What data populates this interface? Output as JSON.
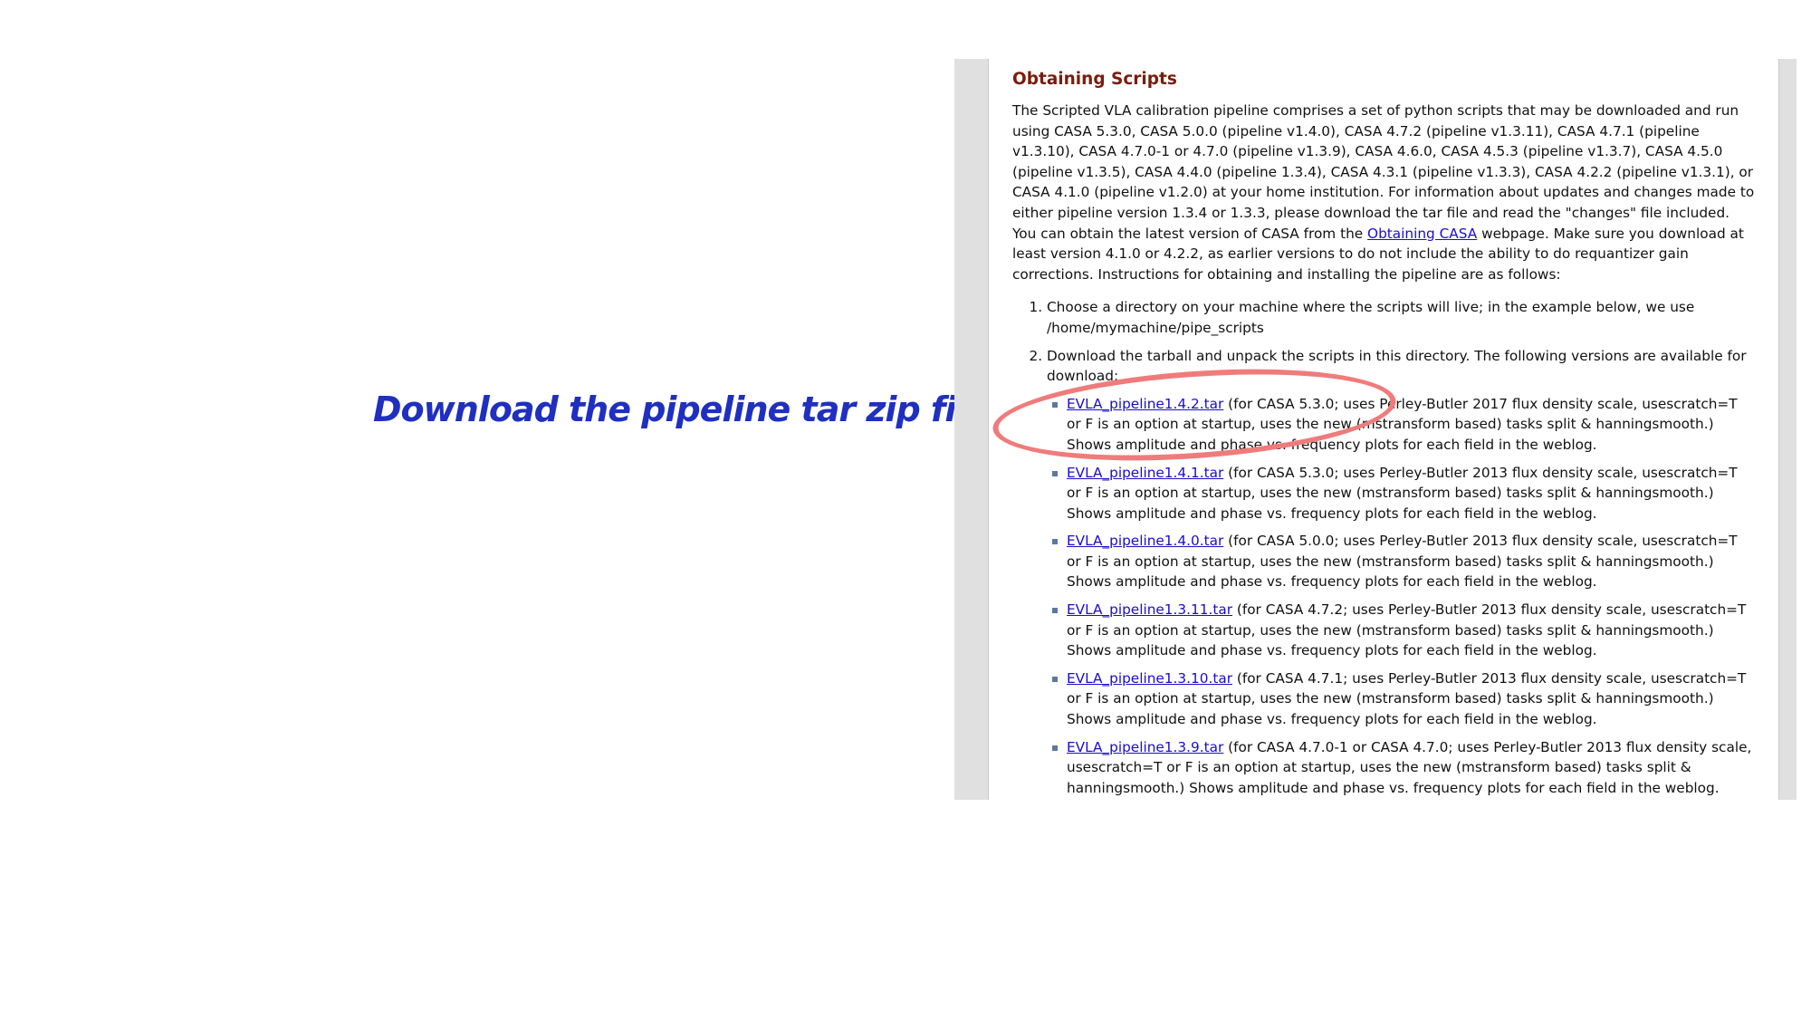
{
  "caption": "Download the pipeline tar zip file.",
  "page": {
    "heading": "Obtaining Scripts",
    "intro": {
      "part1": "The Scripted VLA calibration pipeline comprises a set of python scripts that may be downloaded and run using CASA 5.3.0, CASA 5.0.0 (pipeline v1.4.0),  CASA 4.7.2 (pipeline v1.3.11), CASA 4.7.1 (pipeline v1.3.10), CASA 4.7.0-1 or 4.7.0 (pipeline v1.3.9), CASA 4.6.0, CASA 4.5.3 (pipeline v1.3.7), CASA 4.5.0 (pipeline v1.3.5), CASA 4.4.0 (pipeline 1.3.4), CASA 4.3.1 (pipeline v1.3.3), CASA 4.2.2 (pipeline v1.3.1), or CASA 4.1.0 (pipeline v1.2.0) at your home institution. For information about updates and changes made to either pipeline version 1.3.4 or 1.3.3, please download the tar file and read the \"changes\" file included. You can obtain the latest version of CASA from the ",
      "link": "Obtaining CASA",
      "part2": " webpage.  Make sure you download at least version 4.1.0 or 4.2.2, as earlier versions to do not include the ability to do requantizer gain corrections.  Instructions for obtaining and installing the pipeline are as follows:"
    },
    "steps": [
      "Choose a directory on your machine where the scripts will live; in the example below, we use /home/mymachine/pipe_scripts",
      "Download the tarball and unpack the scripts in this directory.  The following versions are available for download:"
    ],
    "versions": [
      {
        "link": "EVLA_pipeline1.4.2.tar",
        "desc": " (for CASA 5.3.0; uses Perley-Butler 2017 flux density scale, usescratch=T or F is an option at startup, uses the new (mstransform based) tasks split & hanningsmooth.) Shows amplitude and phase vs. frequency plots for each field in the weblog."
      },
      {
        "link": "EVLA_pipeline1.4.1.tar",
        "desc": " (for CASA 5.3.0; uses Perley-Butler 2013 flux density scale, usescratch=T or F is an option at startup, uses the new (mstransform based) tasks split & hanningsmooth.) Shows amplitude and phase vs. frequency plots for each field in the weblog."
      },
      {
        "link": "EVLA_pipeline1.4.0.tar",
        "desc": " (for CASA 5.0.0; uses Perley-Butler 2013 flux density scale, usescratch=T or F is an option at startup, uses the new (mstransform based) tasks split & hanningsmooth.) Shows amplitude and phase vs. frequency plots for each field in the weblog."
      },
      {
        "link": "EVLA_pipeline1.3.11.tar",
        "desc": " (for CASA 4.7.2; uses Perley-Butler 2013 flux density scale, usescratch=T or F is an option at startup, uses the new (mstransform based) tasks split & hanningsmooth.) Shows amplitude and phase vs. frequency plots for each field in the weblog."
      },
      {
        "link": "EVLA_pipeline1.3.10.tar",
        "desc": " (for CASA 4.7.1; uses Perley-Butler 2013 flux density scale, usescratch=T or F is an option at startup, uses the new (mstransform based) tasks split & hanningsmooth.) Shows amplitude and phase vs. frequency plots for each field in the weblog."
      },
      {
        "link": "EVLA_pipeline1.3.9.tar",
        "desc": " (for CASA 4.7.0-1 or CASA 4.7.0; uses Perley-Butler 2013 flux density scale, usescratch=T or F is an option at startup, uses the new (mstransform based) tasks split & hanningsmooth.) Shows amplitude and phase vs. frequency plots for each field in the weblog."
      }
    ]
  },
  "colors": {
    "caption": "#1f2fc0",
    "heading": "#7a1c0c",
    "link": "#1a0dcc",
    "highlight": "#f07b7b"
  }
}
